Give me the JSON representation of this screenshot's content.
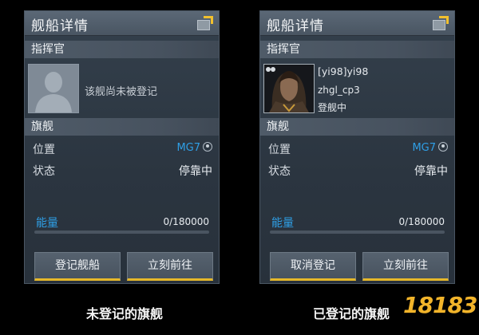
{
  "panels": [
    {
      "title": "舰船详情",
      "commander_header": "指挥官",
      "commander_state": "unregistered",
      "unregistered_text": "该舰尚未被登记",
      "flagship_header": "旗舰",
      "location_label": "位置",
      "location_value": "MG7",
      "status_label": "状态",
      "status_value": "停靠中",
      "energy_label": "能量",
      "energy_value": "0/180000",
      "energy_fraction": 0,
      "button_left": "登记舰船",
      "button_right": "立刻前往",
      "caption": "未登记的旗舰"
    },
    {
      "title": "舰船详情",
      "commander_header": "指挥官",
      "commander_state": "registered",
      "commander_name": "[yi98]yi98",
      "commander_id": "zhgl_cp3",
      "commander_status": "登舰中",
      "flagship_header": "旗舰",
      "location_label": "位置",
      "location_value": "MG7",
      "status_label": "状态",
      "status_value": "停靠中",
      "energy_label": "能量",
      "energy_value": "0/180000",
      "energy_fraction": 0,
      "button_left": "取消登记",
      "button_right": "立刻前往",
      "caption": "已登记的旗舰"
    }
  ],
  "watermark": "18183",
  "colors": {
    "accent_blue": "#2f9fe6",
    "accent_yellow": "#e6b82a"
  },
  "icons": {
    "window": "window-toggle-icon",
    "location": "location-pin-icon",
    "avatar_placeholder": "person-silhouette-icon"
  }
}
